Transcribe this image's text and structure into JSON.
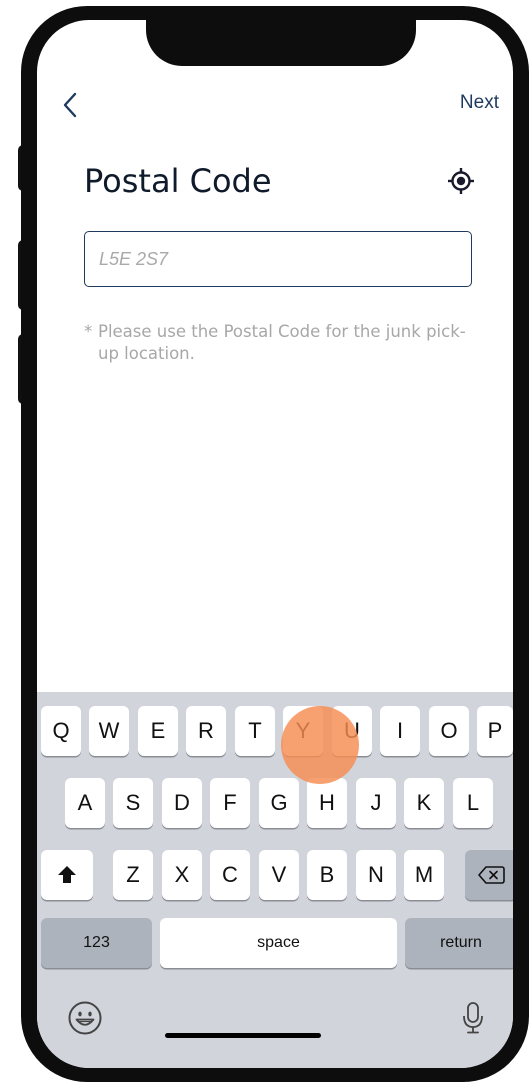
{
  "nav": {
    "back_icon": "chevron-left-icon",
    "next_label": "Next"
  },
  "page": {
    "title": "Postal Code",
    "locate_icon": "crosshair-location-icon"
  },
  "postal_input": {
    "value": "",
    "placeholder": "L5E 2S7"
  },
  "helper": {
    "asterisk": "*",
    "text": "Please use the Postal Code for the junk pick-up location."
  },
  "keyboard": {
    "row1": [
      "Q",
      "W",
      "E",
      "R",
      "T",
      "Y",
      "U",
      "I",
      "O",
      "P"
    ],
    "row2": [
      "A",
      "S",
      "D",
      "F",
      "G",
      "H",
      "J",
      "K",
      "L"
    ],
    "row3": [
      "Z",
      "X",
      "C",
      "V",
      "B",
      "N",
      "M"
    ],
    "shift_icon": "shift-arrow-icon",
    "delete_icon": "backspace-icon",
    "numbers_label": "123",
    "space_label": "space",
    "return_label": "return",
    "emoji_icon": "emoji-smile-icon",
    "mic_icon": "microphone-icon"
  },
  "colors": {
    "accent": "#1f3a5f",
    "helper_text": "#a7a7a7",
    "keyboard_bg": "#d1d4da",
    "tap_indicator": "#f78c50"
  }
}
